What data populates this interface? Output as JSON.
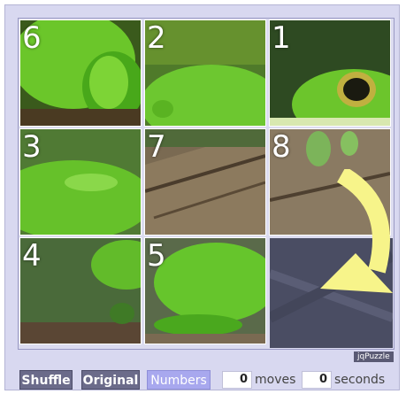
{
  "puzzle": {
    "tiles": [
      {
        "number": "6"
      },
      {
        "number": "2"
      },
      {
        "number": "1"
      },
      {
        "number": "3"
      },
      {
        "number": "7"
      },
      {
        "number": "8"
      },
      {
        "number": "4"
      },
      {
        "number": "5"
      }
    ],
    "badge": "jqPuzzle"
  },
  "controls": {
    "shuffle": "Shuffle",
    "original": "Original",
    "numbers": "Numbers",
    "moves_value": "0",
    "moves_label": "moves",
    "seconds_value": "0",
    "seconds_label": "seconds"
  },
  "colors": {
    "frame": "#d8d8f0",
    "button": "#6b6b8a",
    "button_active": "#a8a8ee",
    "arrow": "#f7f48a"
  }
}
